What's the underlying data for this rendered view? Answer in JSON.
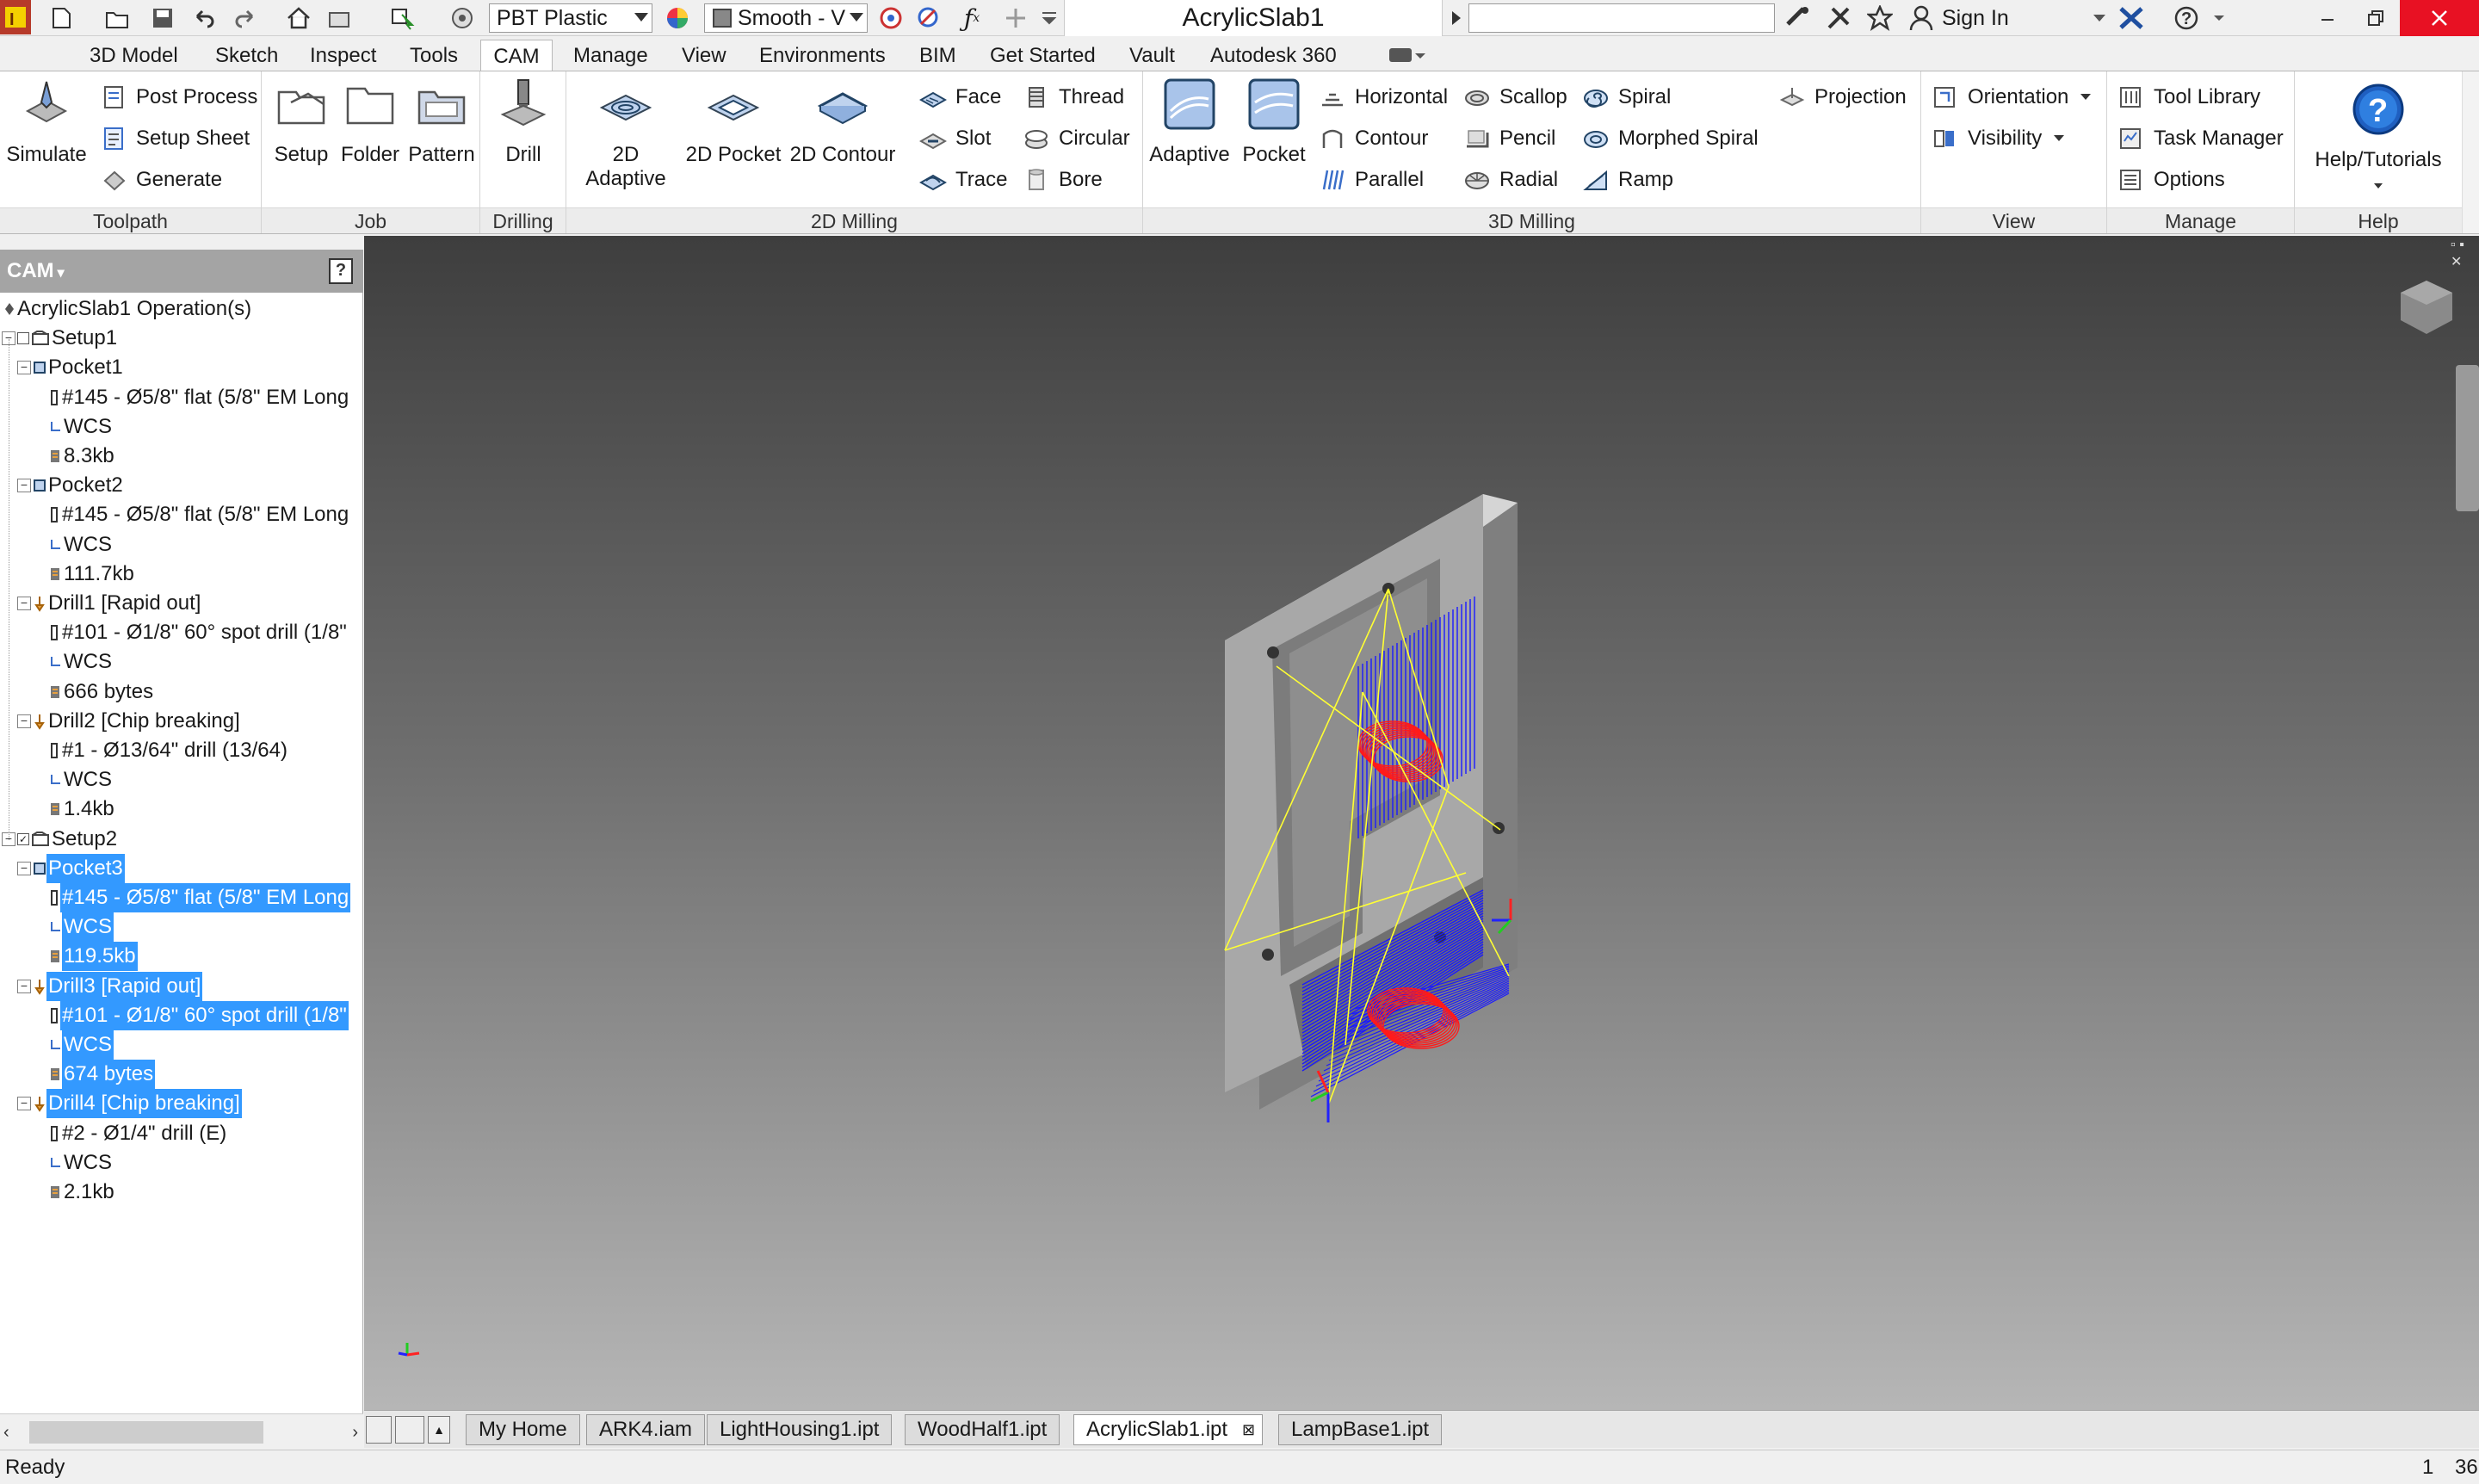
{
  "app": {
    "title": "AcrylicSlab1",
    "material": "PBT Plastic",
    "visual_style": "Smooth - V",
    "search_placeholder": "",
    "sign_in": "Sign In"
  },
  "ribbon_tabs": [
    "3D Model",
    "Sketch",
    "Inspect",
    "Tools",
    "CAM",
    "Manage",
    "View",
    "Environments",
    "BIM",
    "Get Started",
    "Vault",
    "Autodesk 360"
  ],
  "active_tab": "CAM",
  "panels": {
    "toolpath": {
      "label": "Toolpath",
      "simulate": "Simulate",
      "post_process": "Post Process",
      "setup_sheet": "Setup Sheet",
      "generate": "Generate"
    },
    "job": {
      "label": "Job",
      "setup": "Setup",
      "folder": "Folder",
      "pattern": "Pattern"
    },
    "drilling": {
      "label": "Drilling",
      "drill": "Drill"
    },
    "milling2d": {
      "label": "2D Milling",
      "adaptive": "2D Adaptive",
      "pocket": "2D Pocket",
      "contour": "2D Contour",
      "face": "Face",
      "slot": "Slot",
      "trace": "Trace",
      "thread": "Thread",
      "circular": "Circular",
      "bore": "Bore"
    },
    "milling3d": {
      "label": "3D Milling",
      "adaptive": "Adaptive",
      "pocket": "Pocket",
      "horizontal": "Horizontal",
      "contour": "Contour",
      "parallel": "Parallel",
      "scallop": "Scallop",
      "pencil": "Pencil",
      "radial": "Radial",
      "spiral": "Spiral",
      "morphed_spiral": "Morphed Spiral",
      "ramp": "Ramp",
      "projection": "Projection"
    },
    "view": {
      "label": "View",
      "orientation": "Orientation",
      "visibility": "Visibility"
    },
    "manage": {
      "label": "Manage",
      "tool_library": "Tool Library",
      "task_manager": "Task Manager",
      "options": "Options"
    },
    "help": {
      "label": "Help",
      "help_tutorials": "Help/Tutorials"
    }
  },
  "browser": {
    "title": "CAM",
    "root": "AcrylicSlab1 Operation(s)",
    "nodes": [
      {
        "label": "Setup1",
        "level": 0,
        "kind": "setup"
      },
      {
        "label": "Pocket1",
        "level": 1,
        "kind": "op"
      },
      {
        "label": "#145 - Ø5/8\" flat (5/8\" EM Long",
        "level": 2,
        "kind": "tool"
      },
      {
        "label": "WCS",
        "level": 2,
        "kind": "wcs"
      },
      {
        "label": "8.3kb",
        "level": 2,
        "kind": "data"
      },
      {
        "label": "Pocket2",
        "level": 1,
        "kind": "op"
      },
      {
        "label": "#145 - Ø5/8\" flat (5/8\" EM Long",
        "level": 2,
        "kind": "tool"
      },
      {
        "label": "WCS",
        "level": 2,
        "kind": "wcs"
      },
      {
        "label": "111.7kb",
        "level": 2,
        "kind": "data"
      },
      {
        "label": "Drill1 [Rapid out]",
        "level": 1,
        "kind": "drill"
      },
      {
        "label": "#101 - Ø1/8\" 60° spot drill (1/8\"",
        "level": 2,
        "kind": "tool"
      },
      {
        "label": "WCS",
        "level": 2,
        "kind": "wcs"
      },
      {
        "label": "666 bytes",
        "level": 2,
        "kind": "data"
      },
      {
        "label": "Drill2 [Chip breaking]",
        "level": 1,
        "kind": "drill"
      },
      {
        "label": "#1 - Ø13/64\" drill (13/64)",
        "level": 2,
        "kind": "tool"
      },
      {
        "label": "WCS",
        "level": 2,
        "kind": "wcs"
      },
      {
        "label": "1.4kb",
        "level": 2,
        "kind": "data"
      },
      {
        "label": "Setup2",
        "level": 0,
        "kind": "setup"
      },
      {
        "label": "Pocket3",
        "level": 1,
        "kind": "op",
        "sel": true
      },
      {
        "label": "#145 - Ø5/8\" flat (5/8\" EM Long",
        "level": 2,
        "kind": "tool",
        "sel": true
      },
      {
        "label": "WCS",
        "level": 2,
        "kind": "wcs",
        "sel": true
      },
      {
        "label": "119.5kb",
        "level": 2,
        "kind": "data",
        "sel": true
      },
      {
        "label": "Drill3 [Rapid out]",
        "level": 1,
        "kind": "drill",
        "sel": true
      },
      {
        "label": "#101 - Ø1/8\" 60° spot drill (1/8\"",
        "level": 2,
        "kind": "tool",
        "sel": true
      },
      {
        "label": "WCS",
        "level": 2,
        "kind": "wcs",
        "sel": true
      },
      {
        "label": "674 bytes",
        "level": 2,
        "kind": "data",
        "sel": true
      },
      {
        "label": "Drill4 [Chip breaking]",
        "level": 1,
        "kind": "drill",
        "sel": true
      },
      {
        "label": "#2 - Ø1/4\" drill (E)",
        "level": 2,
        "kind": "tool"
      },
      {
        "label": "WCS",
        "level": 2,
        "kind": "wcs"
      },
      {
        "label": "2.1kb",
        "level": 2,
        "kind": "data"
      }
    ]
  },
  "doc_tabs": [
    "My Home",
    "ARK4.iam",
    "LightHousing1.ipt",
    "WoodHalf1.ipt",
    "AcrylicSlab1.ipt",
    "LampBase1.ipt"
  ],
  "active_doc": "AcrylicSlab1.ipt",
  "status": {
    "text": "Ready",
    "page": "1",
    "count": "36"
  },
  "axes": {
    "x": "X",
    "y": "Y",
    "z": "Z"
  },
  "colors": {
    "selection": "#3399ff",
    "toolpath_blue": "#1a1aff",
    "toolpath_red": "#ff1a1a",
    "toolpath_yellow": "#ffff33",
    "part_face": "#a6a6a6"
  }
}
